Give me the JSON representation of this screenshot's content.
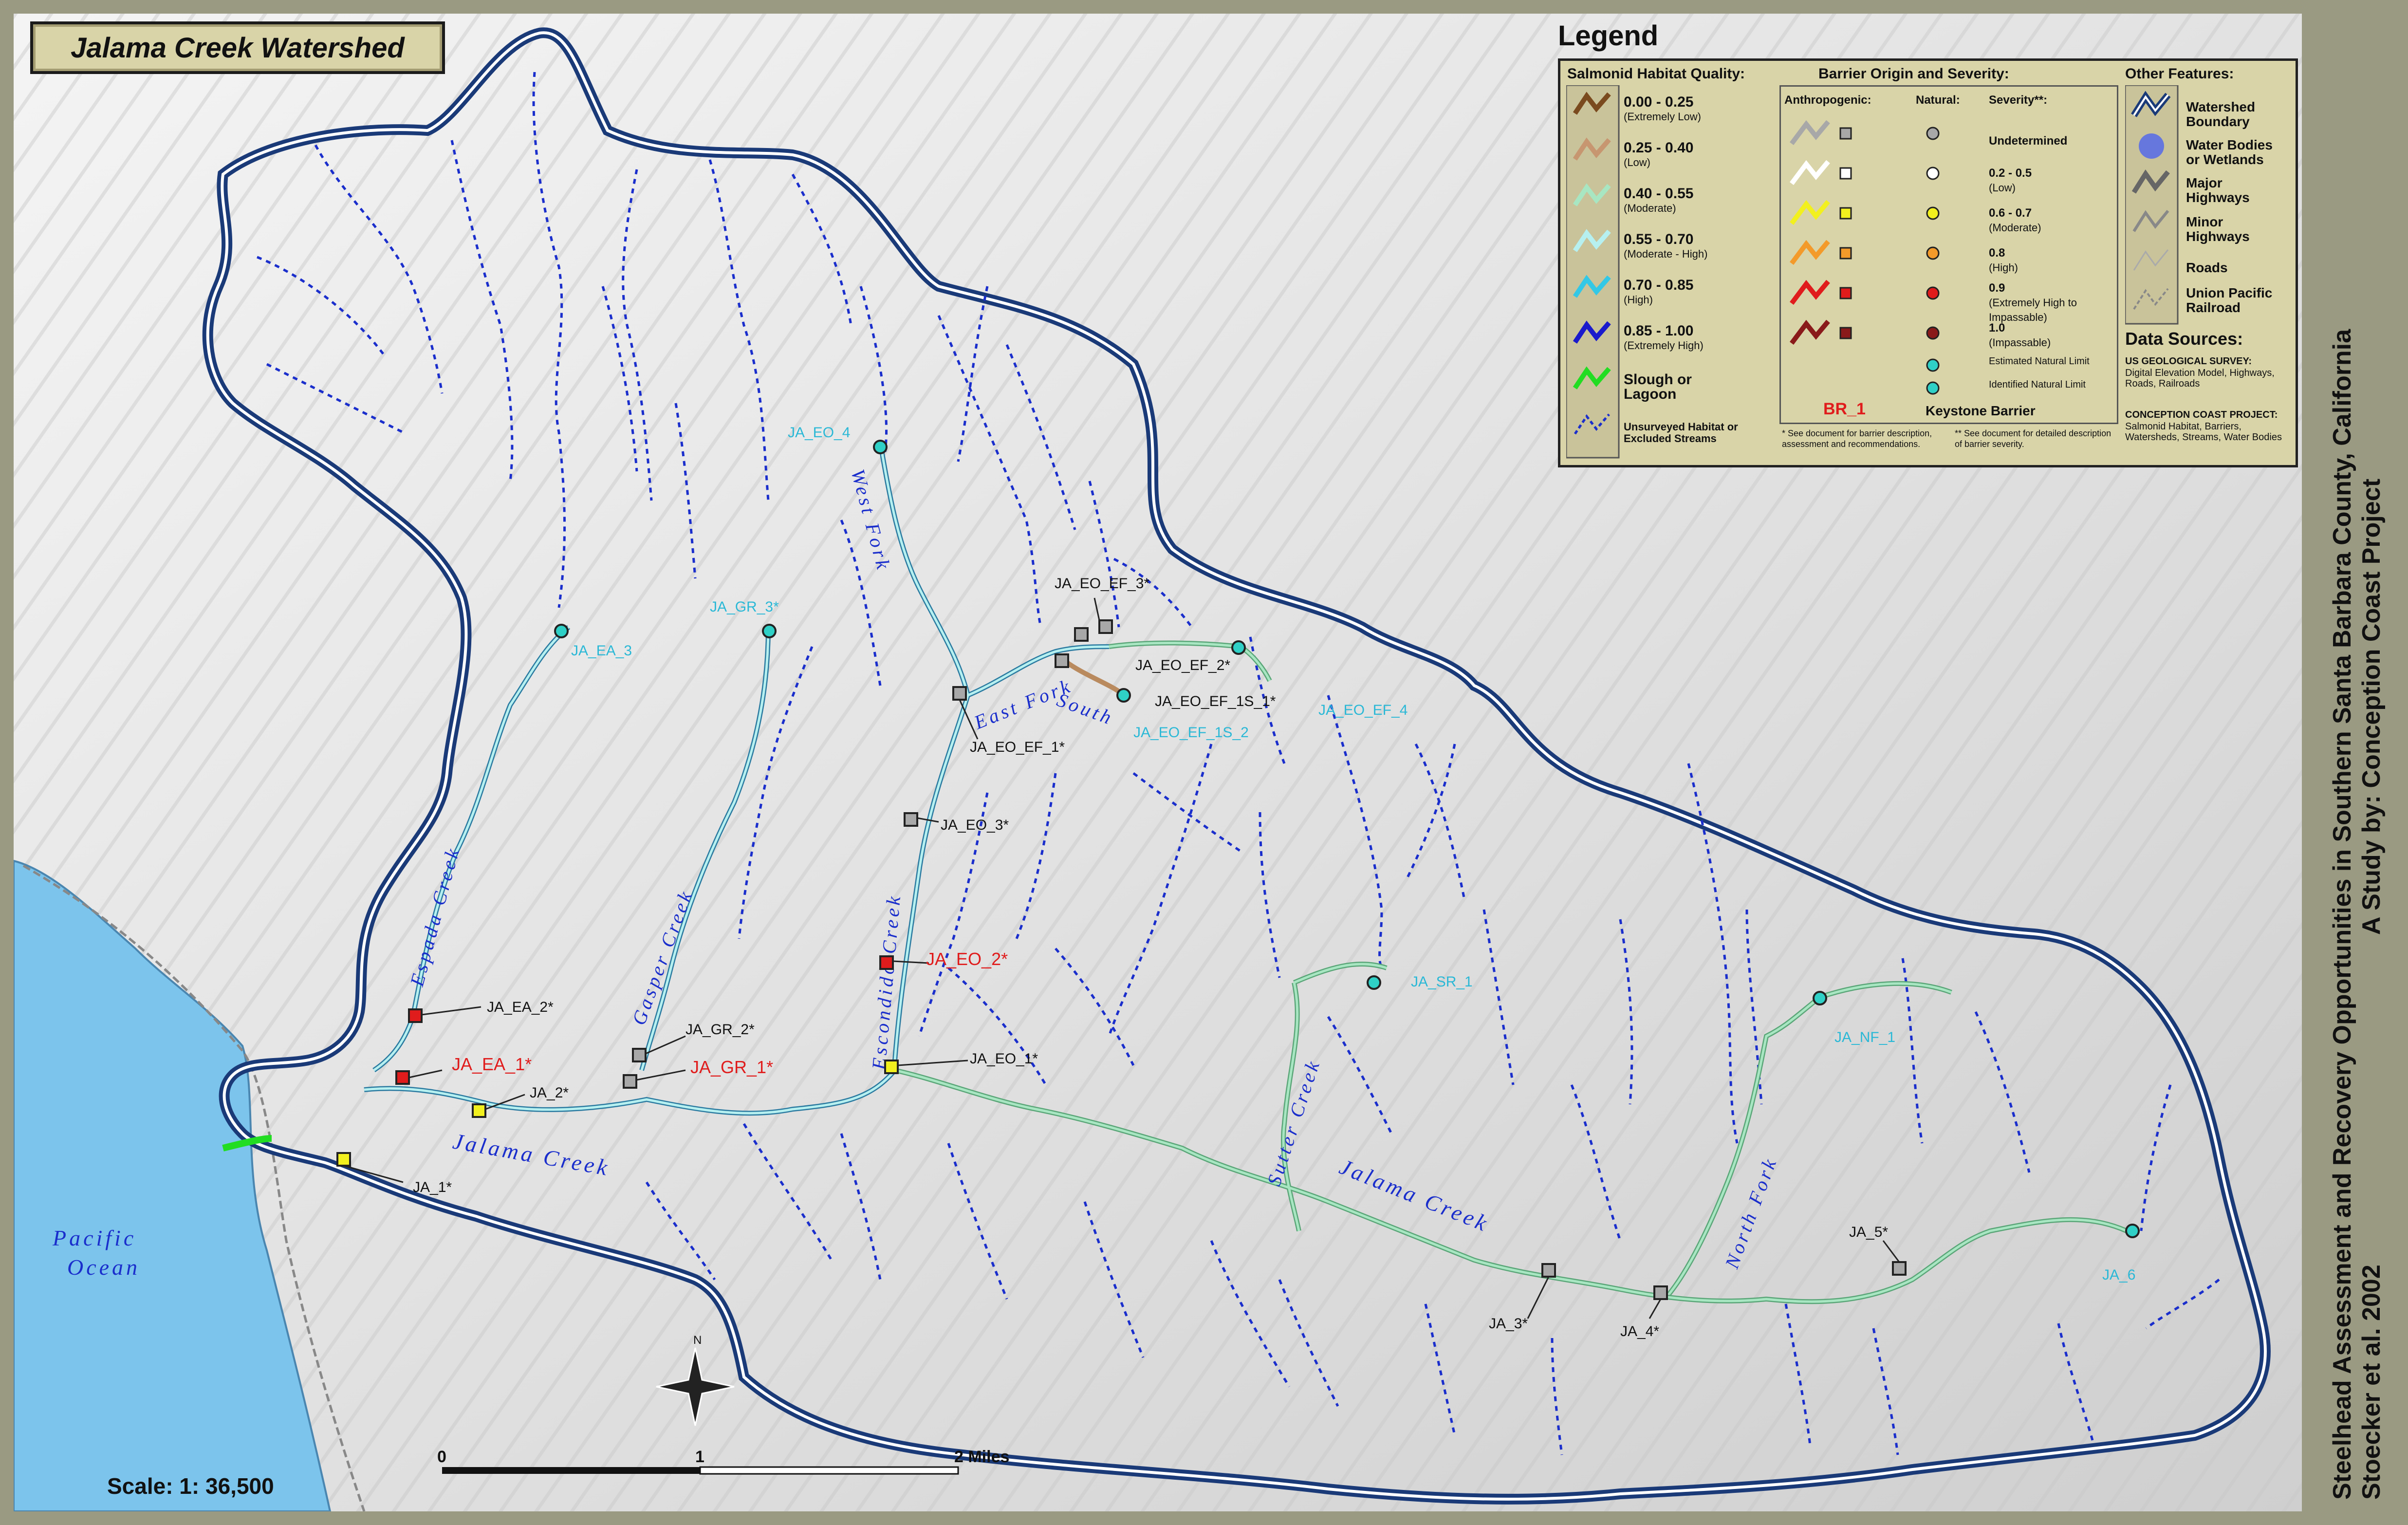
{
  "title": "Jalama Creek Watershed",
  "side_title_line1": "Steelhead Assessment and Recovery Opportunities in Southern Santa Barbara County, California",
  "side_title_line2": "Stoecker et al. 2002",
  "side_title_credit": "A Study by: Conception Coast Project",
  "scale": "Scale: 1: 36,500",
  "scale_ticks": [
    "0",
    "1",
    "2  Miles"
  ],
  "north": "N",
  "ocean_label_1": "Pacific",
  "ocean_label_2": "Ocean",
  "colors": {
    "boundary": "#1a3a78",
    "stream_dotted": "#1a2ecc",
    "habitat_moderate": "#9fe0b8",
    "habitat_mod_high": "#a9ecec",
    "habitat_low": "#b98a5e",
    "slough": "#22dd22",
    "barrier_red": "#e01c1c",
    "barrier_yellow": "#f2f01e",
    "barrier_grey": "#a8a8a8",
    "ocean": "#7cc4ec"
  },
  "creek_labels": [
    "Espada Creek",
    "Gasper Creek",
    "Escondido Creek",
    "West Fork",
    "East Fork",
    "South",
    "Sutter Creek",
    "Jalama Creek",
    "Jalama Creek",
    "North Fork"
  ],
  "barriers": [
    {
      "id": "JA_1*",
      "color": "yellow"
    },
    {
      "id": "JA_2*",
      "color": "yellow"
    },
    {
      "id": "JA_3*",
      "color": "grey"
    },
    {
      "id": "JA_4*",
      "color": "grey"
    },
    {
      "id": "JA_5*",
      "color": "grey"
    },
    {
      "id": "JA_6",
      "color": "cyan"
    },
    {
      "id": "JA_EA_1*",
      "color": "red"
    },
    {
      "id": "JA_EA_2*",
      "color": "red"
    },
    {
      "id": "JA_EA_3",
      "color": "cyan"
    },
    {
      "id": "JA_GR_1*",
      "color": "red"
    },
    {
      "id": "JA_GR_2*",
      "color": "grey"
    },
    {
      "id": "JA_GR_3*",
      "color": "cyan"
    },
    {
      "id": "JA_EO_1*",
      "color": "yellow"
    },
    {
      "id": "JA_EO_2*",
      "color": "red"
    },
    {
      "id": "JA_EO_3*",
      "color": "grey"
    },
    {
      "id": "JA_EO_4",
      "color": "cyan"
    },
    {
      "id": "JA_EO_EF_1*",
      "color": "grey"
    },
    {
      "id": "JA_EO_EF_2*",
      "color": "grey"
    },
    {
      "id": "JA_EO_EF_3*",
      "color": "grey"
    },
    {
      "id": "JA_EO_EF_4",
      "color": "cyan"
    },
    {
      "id": "JA_EO_EF_1S_1*",
      "color": "grey"
    },
    {
      "id": "JA_EO_EF_1S_2",
      "color": "cyan"
    },
    {
      "id": "JA_SR_1",
      "color": "cyan"
    },
    {
      "id": "JA_NF_1",
      "color": "cyan"
    }
  ],
  "legend": {
    "title": "Legend",
    "col1_head": "Salmonid Habitat Quality:",
    "col2_head": "Barrier Origin and Severity:",
    "col3_head": "Other Features:",
    "habitat": [
      {
        "range": "0.00 - 0.25",
        "desc": "(Extremely Low)",
        "color": "#7a4a1e"
      },
      {
        "range": "0.25 - 0.40",
        "desc": "(Low)",
        "color": "#c79670"
      },
      {
        "range": "0.40 - 0.55",
        "desc": "(Moderate)",
        "color": "#a8e6c2"
      },
      {
        "range": "0.55 - 0.70",
        "desc": "(Moderate - High)",
        "color": "#b6f0f0"
      },
      {
        "range": "0.70 - 0.85",
        "desc": "(High)",
        "color": "#33c8e6"
      },
      {
        "range": "0.85 - 1.00",
        "desc": "(Extremely High)",
        "color": "#1a1acc"
      },
      {
        "range": "Slough or Lagoon",
        "desc": "",
        "color": "#22dd22"
      },
      {
        "range": "Unsurveyed Habitat or Excluded Streams",
        "desc": "",
        "color": "#1a2ecc"
      }
    ],
    "sub_heads": [
      "Anthropogenic:",
      "Natural:",
      "Severity**:"
    ],
    "severity": [
      {
        "label": "Undetermined",
        "color": "#a8a8a8"
      },
      {
        "label": "0.2 - 0.5",
        "desc": "(Low)",
        "color": "#ffffff"
      },
      {
        "label": "0.6 - 0.7",
        "desc": "(Moderate)",
        "color": "#f2f01e"
      },
      {
        "label": "0.8",
        "desc": "(High)",
        "color": "#f39a2a"
      },
      {
        "label": "0.9",
        "desc": "(Extremely High to Impassable)",
        "color": "#e01c1c"
      },
      {
        "label": "1.0",
        "desc": "(Impassable)",
        "color": "#8a1a1a"
      }
    ],
    "estimated": "Estimated Natural Limit",
    "identified": "Identified Natural Limit",
    "br1": "BR_1",
    "keystone": "Keystone Barrier",
    "note1": "* See document for barrier description, assessment and recommendations.",
    "note2": "** See document for detailed description of barrier severity.",
    "other": [
      "Watershed Boundary",
      "Water Bodies or Wetlands",
      "Major Highways",
      "Minor Highways",
      "Roads",
      "Union Pacific Railroad"
    ],
    "data_sources_head": "Data Sources:",
    "usgs_head": "US GEOLOGICAL SURVEY:",
    "usgs_text": "Digital Elevation Model, Highways, Roads, Railroads",
    "ccp_head": "CONCEPTION COAST PROJECT:",
    "ccp_text": "Salmonid Habitat, Barriers, Watersheds, Streams, Water Bodies"
  }
}
